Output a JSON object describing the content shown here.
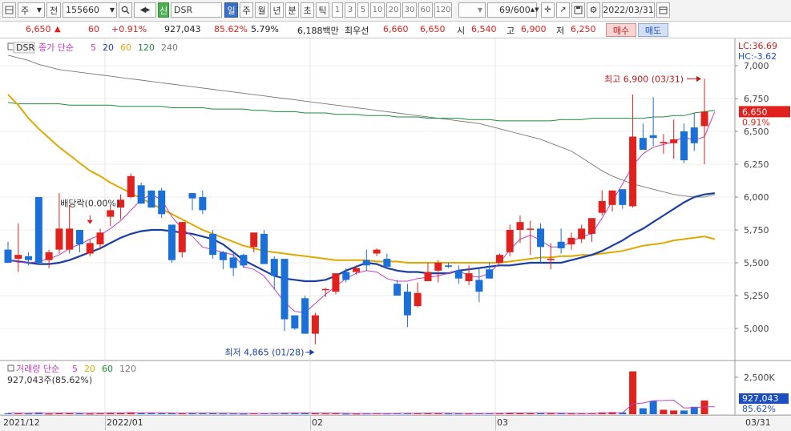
{
  "toolbar": {
    "period_button": "주",
    "prev_label": "전",
    "code": "155660",
    "name_badge": "신",
    "name": "DSR",
    "period_tabs": [
      "일",
      "주",
      "월",
      "년",
      "분",
      "초",
      "틱"
    ],
    "active_period": "일",
    "interval_tabs": [
      "1",
      "3",
      "5",
      "10",
      "20",
      "30",
      "60",
      "120"
    ],
    "count": "69/600",
    "date": "2022/03/31"
  },
  "quote": {
    "price": "6,650",
    "direction": "▲",
    "change": "60",
    "change_pct": "+0.91%",
    "volume": "927,043",
    "volume_ratio": "85.62%",
    "turnover": "5.79%",
    "amount": "6,188백만",
    "best_label": "최우선",
    "ask": "6,660",
    "bid": "6,650",
    "open_label": "시",
    "open": "6,540",
    "high_label": "고",
    "high": "6,900",
    "low_label": "저",
    "low": "6,250",
    "buy_label": "매수",
    "sell_label": "매도"
  },
  "price_panel": {
    "symbol": "DSR",
    "indicator_label": "종가 단순",
    "ma_periods": [
      {
        "label": "5",
        "color": "#c040c0"
      },
      {
        "label": "20",
        "color": "#1b3fa0"
      },
      {
        "label": "60",
        "color": "#e0a800"
      },
      {
        "label": "120",
        "color": "#1f8a3a"
      },
      {
        "label": "240",
        "color": "#777777"
      }
    ],
    "lc": "LC:36.69",
    "hc": "HC:-3.62",
    "current_price_tag": "6,650",
    "current_pct_tag": "0.91%",
    "high_annotation": "최고 6,900 (03/31)",
    "low_annotation": "최저 4,865 (01/28)",
    "dividend_annotation": "배당락(0.00%)",
    "y_ticks": [
      "7,000",
      "6,750",
      "6,500",
      "6,250",
      "6,000",
      "5,750",
      "5,500",
      "5,250",
      "5,000"
    ]
  },
  "volume_panel": {
    "title": "거래량 단순",
    "ma_periods": [
      {
        "label": "5",
        "color": "#c040c0"
      },
      {
        "label": "20",
        "color": "#e0a800"
      },
      {
        "label": "60",
        "color": "#1f8a3a"
      },
      {
        "label": "120",
        "color": "#777777"
      }
    ],
    "summary": "927,043주(85.62%)",
    "y_tick": "2,500K",
    "current_tag": "927,043",
    "current_pct_tag": "85.62%"
  },
  "x_axis": {
    "labels": [
      "2021/12",
      "2022/01",
      "02",
      "03"
    ],
    "last_date": "03/31"
  },
  "colors": {
    "up": "#e0211d",
    "down": "#1b6fd8"
  },
  "chart_data": {
    "type": "candlestick",
    "ylim": [
      4800,
      7100
    ],
    "candles": [
      {
        "o": 5600,
        "h": 5660,
        "l": 5500,
        "c": 5500
      },
      {
        "o": 5530,
        "h": 5800,
        "l": 5430,
        "c": 5560
      },
      {
        "o": 5550,
        "h": 5580,
        "l": 5480,
        "c": 5520
      },
      {
        "o": 6000,
        "h": 6000,
        "l": 5490,
        "c": 5500
      },
      {
        "o": 5520,
        "h": 5600,
        "l": 5460,
        "c": 5580
      },
      {
        "o": 5600,
        "h": 6030,
        "l": 5570,
        "c": 5760
      },
      {
        "o": 5600,
        "h": 5940,
        "l": 5570,
        "c": 5760
      },
      {
        "o": 5750,
        "h": 5750,
        "l": 5580,
        "c": 5640
      },
      {
        "o": 5570,
        "h": 5680,
        "l": 5550,
        "c": 5650
      },
      {
        "o": 5640,
        "h": 5760,
        "l": 5600,
        "c": 5730
      },
      {
        "o": 5850,
        "h": 5940,
        "l": 5780,
        "c": 5900
      },
      {
        "o": 5920,
        "h": 6020,
        "l": 5830,
        "c": 5980
      },
      {
        "o": 6000,
        "h": 6180,
        "l": 5990,
        "c": 6160
      },
      {
        "o": 6090,
        "h": 6110,
        "l": 5960,
        "c": 5950
      },
      {
        "o": 6050,
        "h": 6040,
        "l": 5930,
        "c": 5920
      },
      {
        "o": 6050,
        "h": 6070,
        "l": 5840,
        "c": 5870
      },
      {
        "o": 5790,
        "h": 5790,
        "l": 5500,
        "c": 5520
      },
      {
        "o": 5580,
        "h": 5810,
        "l": 5540,
        "c": 5810
      },
      {
        "o": 6030,
        "h": 6030,
        "l": 5900,
        "c": 5990
      },
      {
        "o": 6000,
        "h": 6050,
        "l": 5870,
        "c": 5900
      },
      {
        "o": 5720,
        "h": 5750,
        "l": 5530,
        "c": 5560
      },
      {
        "o": 5580,
        "h": 5590,
        "l": 5450,
        "c": 5520
      },
      {
        "o": 5540,
        "h": 5590,
        "l": 5400,
        "c": 5460
      },
      {
        "o": 5560,
        "h": 5570,
        "l": 5460,
        "c": 5480
      },
      {
        "o": 5620,
        "h": 5720,
        "l": 5580,
        "c": 5730
      },
      {
        "o": 5720,
        "h": 5750,
        "l": 5560,
        "c": 5490
      },
      {
        "o": 5530,
        "h": 5550,
        "l": 5300,
        "c": 5400
      },
      {
        "o": 5530,
        "h": 5490,
        "l": 4980,
        "c": 5070
      },
      {
        "o": 5100,
        "h": 5080,
        "l": 4990,
        "c": 5000
      },
      {
        "o": 5230,
        "h": 5250,
        "l": 4960,
        "c": 4960
      },
      {
        "o": 4960,
        "h": 5120,
        "l": 4880,
        "c": 5100
      },
      {
        "o": 5300,
        "h": 5310,
        "l": 5240,
        "c": 5300
      },
      {
        "o": 5280,
        "h": 5420,
        "l": 5260,
        "c": 5420
      },
      {
        "o": 5430,
        "h": 5460,
        "l": 5350,
        "c": 5370
      },
      {
        "o": 5430,
        "h": 5480,
        "l": 5410,
        "c": 5460
      },
      {
        "o": 5520,
        "h": 5600,
        "l": 5440,
        "c": 5480
      },
      {
        "o": 5570,
        "h": 5610,
        "l": 5550,
        "c": 5600
      },
      {
        "o": 5530,
        "h": 5570,
        "l": 5470,
        "c": 5470
      },
      {
        "o": 5340,
        "h": 5370,
        "l": 5250,
        "c": 5250
      },
      {
        "o": 5280,
        "h": 5340,
        "l": 5010,
        "c": 5100
      },
      {
        "o": 5170,
        "h": 5350,
        "l": 5160,
        "c": 5270
      },
      {
        "o": 5360,
        "h": 5500,
        "l": 5380,
        "c": 5430
      },
      {
        "o": 5440,
        "h": 5520,
        "l": 5350,
        "c": 5500
      },
      {
        "o": 5480,
        "h": 5500,
        "l": 5460,
        "c": 5470
      },
      {
        "o": 5440,
        "h": 5480,
        "l": 5340,
        "c": 5380
      },
      {
        "o": 5360,
        "h": 5480,
        "l": 5330,
        "c": 5420
      },
      {
        "o": 5370,
        "h": 5460,
        "l": 5200,
        "c": 5280
      },
      {
        "o": 5450,
        "h": 5500,
        "l": 5380,
        "c": 5380
      },
      {
        "o": 5500,
        "h": 5570,
        "l": 5500,
        "c": 5560
      },
      {
        "o": 5580,
        "h": 5790,
        "l": 5550,
        "c": 5750
      },
      {
        "o": 5750,
        "h": 5860,
        "l": 5650,
        "c": 5810
      },
      {
        "o": 5760,
        "h": 5820,
        "l": 5560,
        "c": 5760
      },
      {
        "o": 5760,
        "h": 5800,
        "l": 5500,
        "c": 5620
      },
      {
        "o": 5520,
        "h": 5650,
        "l": 5450,
        "c": 5530
      },
      {
        "o": 5660,
        "h": 5760,
        "l": 5570,
        "c": 5610
      },
      {
        "o": 5640,
        "h": 5730,
        "l": 5600,
        "c": 5690
      },
      {
        "o": 5680,
        "h": 5790,
        "l": 5650,
        "c": 5760
      },
      {
        "o": 5720,
        "h": 5800,
        "l": 5660,
        "c": 5840
      },
      {
        "o": 5880,
        "h": 6050,
        "l": 5860,
        "c": 5970
      },
      {
        "o": 5940,
        "h": 6050,
        "l": 5890,
        "c": 6050
      },
      {
        "o": 6060,
        "h": 6000,
        "l": 5910,
        "c": 5940
      },
      {
        "o": 5930,
        "h": 6780,
        "l": 5920,
        "c": 6460
      },
      {
        "o": 6450,
        "h": 6560,
        "l": 6380,
        "c": 6360
      },
      {
        "o": 6470,
        "h": 6760,
        "l": 6390,
        "c": 6450
      },
      {
        "o": 6410,
        "h": 6480,
        "l": 6330,
        "c": 6420
      },
      {
        "o": 6410,
        "h": 6590,
        "l": 6290,
        "c": 6440
      },
      {
        "o": 6500,
        "h": 6560,
        "l": 6260,
        "c": 6280
      },
      {
        "o": 6530,
        "h": 6640,
        "l": 6350,
        "c": 6410
      },
      {
        "o": 6540,
        "h": 6900,
        "l": 6250,
        "c": 6650
      }
    ],
    "ma5": [
      5520,
      5505,
      5500,
      5510,
      5530,
      5560,
      5610,
      5640,
      5680,
      5710,
      5760,
      5820,
      5900,
      5980,
      6020,
      5980,
      5850,
      5760,
      5700,
      5620,
      5600,
      5580,
      5560,
      5470,
      5450,
      5400,
      5300,
      5200,
      5130,
      5120,
      5190,
      5260,
      5320,
      5380,
      5420,
      5440,
      5430,
      5380,
      5360,
      5360,
      5380,
      5390,
      5400,
      5420,
      5440,
      5400,
      5390,
      5420,
      5500,
      5600,
      5680,
      5710,
      5670,
      5620,
      5620,
      5660,
      5700,
      5720,
      5840,
      5970,
      6100,
      6240,
      6330,
      6380,
      6400,
      6420,
      6460,
      6430,
      6460,
      6650
    ],
    "ma20": [
      5520,
      5510,
      5500,
      5490,
      5490,
      5500,
      5520,
      5550,
      5580,
      5610,
      5650,
      5690,
      5720,
      5740,
      5750,
      5750,
      5740,
      5730,
      5720,
      5700,
      5680,
      5640,
      5580,
      5520,
      5480,
      5440,
      5400,
      5380,
      5370,
      5360,
      5360,
      5370,
      5400,
      5440,
      5470,
      5500,
      5490,
      5460,
      5440,
      5430,
      5430,
      5420,
      5420,
      5420,
      5440,
      5450,
      5460,
      5470,
      5480,
      5480,
      5490,
      5500,
      5500,
      5500,
      5500,
      5520,
      5540,
      5560,
      5590,
      5630,
      5670,
      5720,
      5760,
      5810,
      5860,
      5910,
      5960,
      6000,
      6020,
      6030
    ],
    "ma60": [
      6780,
      6700,
      6600,
      6520,
      6450,
      6380,
      6320,
      6260,
      6200,
      6160,
      6110,
      6070,
      6030,
      5990,
      5950,
      5910,
      5870,
      5830,
      5790,
      5750,
      5720,
      5690,
      5660,
      5630,
      5610,
      5590,
      5580,
      5570,
      5560,
      5550,
      5540,
      5530,
      5520,
      5520,
      5520,
      5520,
      5510,
      5510,
      5510,
      5500,
      5500,
      5500,
      5500,
      5500,
      5500,
      5500,
      5500,
      5500,
      5500,
      5510,
      5520,
      5530,
      5540,
      5540,
      5550,
      5550,
      5560,
      5560,
      5570,
      5580,
      5590,
      5610,
      5630,
      5640,
      5650,
      5670,
      5680,
      5690,
      5700,
      5680
    ],
    "ma120": [
      6720,
      6710,
      6710,
      6710,
      6710,
      6710,
      6700,
      6700,
      6700,
      6700,
      6700,
      6690,
      6690,
      6690,
      6690,
      6690,
      6680,
      6680,
      6680,
      6680,
      6670,
      6670,
      6670,
      6670,
      6660,
      6660,
      6650,
      6650,
      6650,
      6640,
      6640,
      6640,
      6630,
      6630,
      6630,
      6620,
      6620,
      6620,
      6610,
      6610,
      6610,
      6600,
      6600,
      6600,
      6600,
      6590,
      6590,
      6590,
      6580,
      6580,
      6580,
      6580,
      6580,
      6580,
      6590,
      6590,
      6590,
      6600,
      6600,
      6600,
      6600,
      6600,
      6600,
      6610,
      6610,
      6620,
      6620,
      6640,
      6650,
      6660
    ],
    "ma240": [
      7080,
      7060,
      7040,
      7010,
      6990,
      6970,
      6960,
      6950,
      6940,
      6930,
      6920,
      6910,
      6900,
      6890,
      6880,
      6870,
      6860,
      6850,
      6840,
      6830,
      6820,
      6810,
      6800,
      6790,
      6780,
      6770,
      6760,
      6750,
      6740,
      6730,
      6720,
      6710,
      6700,
      6690,
      6680,
      6670,
      6660,
      6650,
      6640,
      6630,
      6620,
      6610,
      6600,
      6590,
      6580,
      6570,
      6560,
      6540,
      6520,
      6500,
      6480,
      6460,
      6440,
      6410,
      6380,
      6350,
      6300,
      6250,
      6200,
      6160,
      6130,
      6100,
      6080,
      6060,
      6040,
      6020,
      6010,
      6000,
      6000,
      6020
    ],
    "volumes_k": [
      60,
      70,
      50,
      120,
      40,
      90,
      80,
      50,
      40,
      60,
      110,
      90,
      130,
      80,
      70,
      60,
      70,
      80,
      90,
      70,
      60,
      50,
      50,
      40,
      70,
      60,
      80,
      90,
      70,
      100,
      60,
      50,
      60,
      40,
      40,
      50,
      60,
      50,
      60,
      80,
      70,
      70,
      60,
      50,
      50,
      50,
      60,
      60,
      70,
      100,
      90,
      70,
      60,
      50,
      60,
      50,
      60,
      60,
      120,
      140,
      120,
      2900,
      400,
      900,
      300,
      250,
      250,
      500,
      927
    ],
    "volume_ma5_k": [
      70,
      70,
      70,
      72,
      68,
      70,
      74,
      72,
      66,
      66,
      74,
      80,
      84,
      86,
      90,
      86,
      78,
      72,
      74,
      74,
      74,
      66,
      62,
      54,
      54,
      56,
      62,
      70,
      74,
      80,
      76,
      70,
      68,
      62,
      50,
      48,
      50,
      50,
      52,
      58,
      62,
      66,
      66,
      66,
      60,
      56,
      56,
      56,
      58,
      66,
      74,
      78,
      78,
      74,
      66,
      58,
      56,
      56,
      68,
      86,
      100,
      690,
      760,
      910,
      920,
      950,
      420,
      440,
      500,
      500
    ],
    "volume_ylim": [
      0,
      3200
    ]
  }
}
